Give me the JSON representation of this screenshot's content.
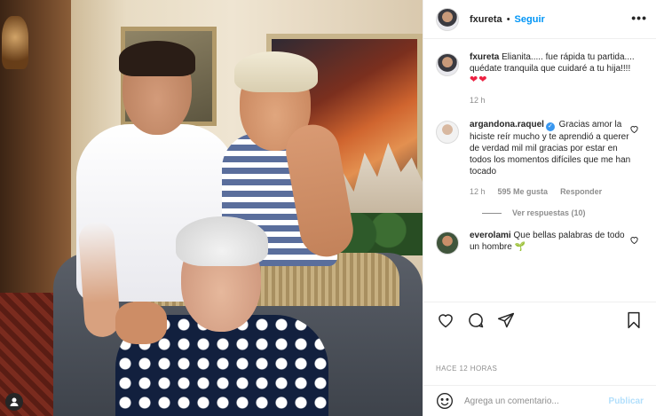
{
  "post": {
    "username": "fxureta",
    "follow_label": "Seguir",
    "separator": "•",
    "more_label": "•••"
  },
  "caption": {
    "username": "fxureta",
    "text": " Elianita..... fue rápida tu partida.... quédate tranquila que cuidaré a tu hija!!!! ",
    "emoji": "❤❤",
    "time": "12 h"
  },
  "comments": [
    {
      "username": "argandona.raquel",
      "verified_mark": "✓",
      "text": " Gracias amor la hiciste reír mucho y te aprendió a querer de verdad mil mil gracias por estar en todos los momentos difíciles que me han tocado",
      "time": "12 h",
      "likes": "595 Me gusta",
      "reply_label": "Responder",
      "view_replies": "Ver respuestas (10)"
    },
    {
      "username": "everolami",
      "text": " Que bellas palabras de todo un hombre ",
      "emoji": "🌱"
    }
  ],
  "footer": {
    "timestamp": "HACE 12 HORAS",
    "comment_placeholder": "Agrega un comentario...",
    "publish_label": "Publicar"
  },
  "icons": [
    "heart-icon",
    "comment-icon",
    "share-icon",
    "bookmark-icon",
    "emoji-icon",
    "user-icon"
  ],
  "colors": {
    "link_blue": "#0095f6",
    "publish_disabled": "#b2dffc",
    "heart_red": "#ed2142",
    "muted_text": "#8e8e8e"
  }
}
